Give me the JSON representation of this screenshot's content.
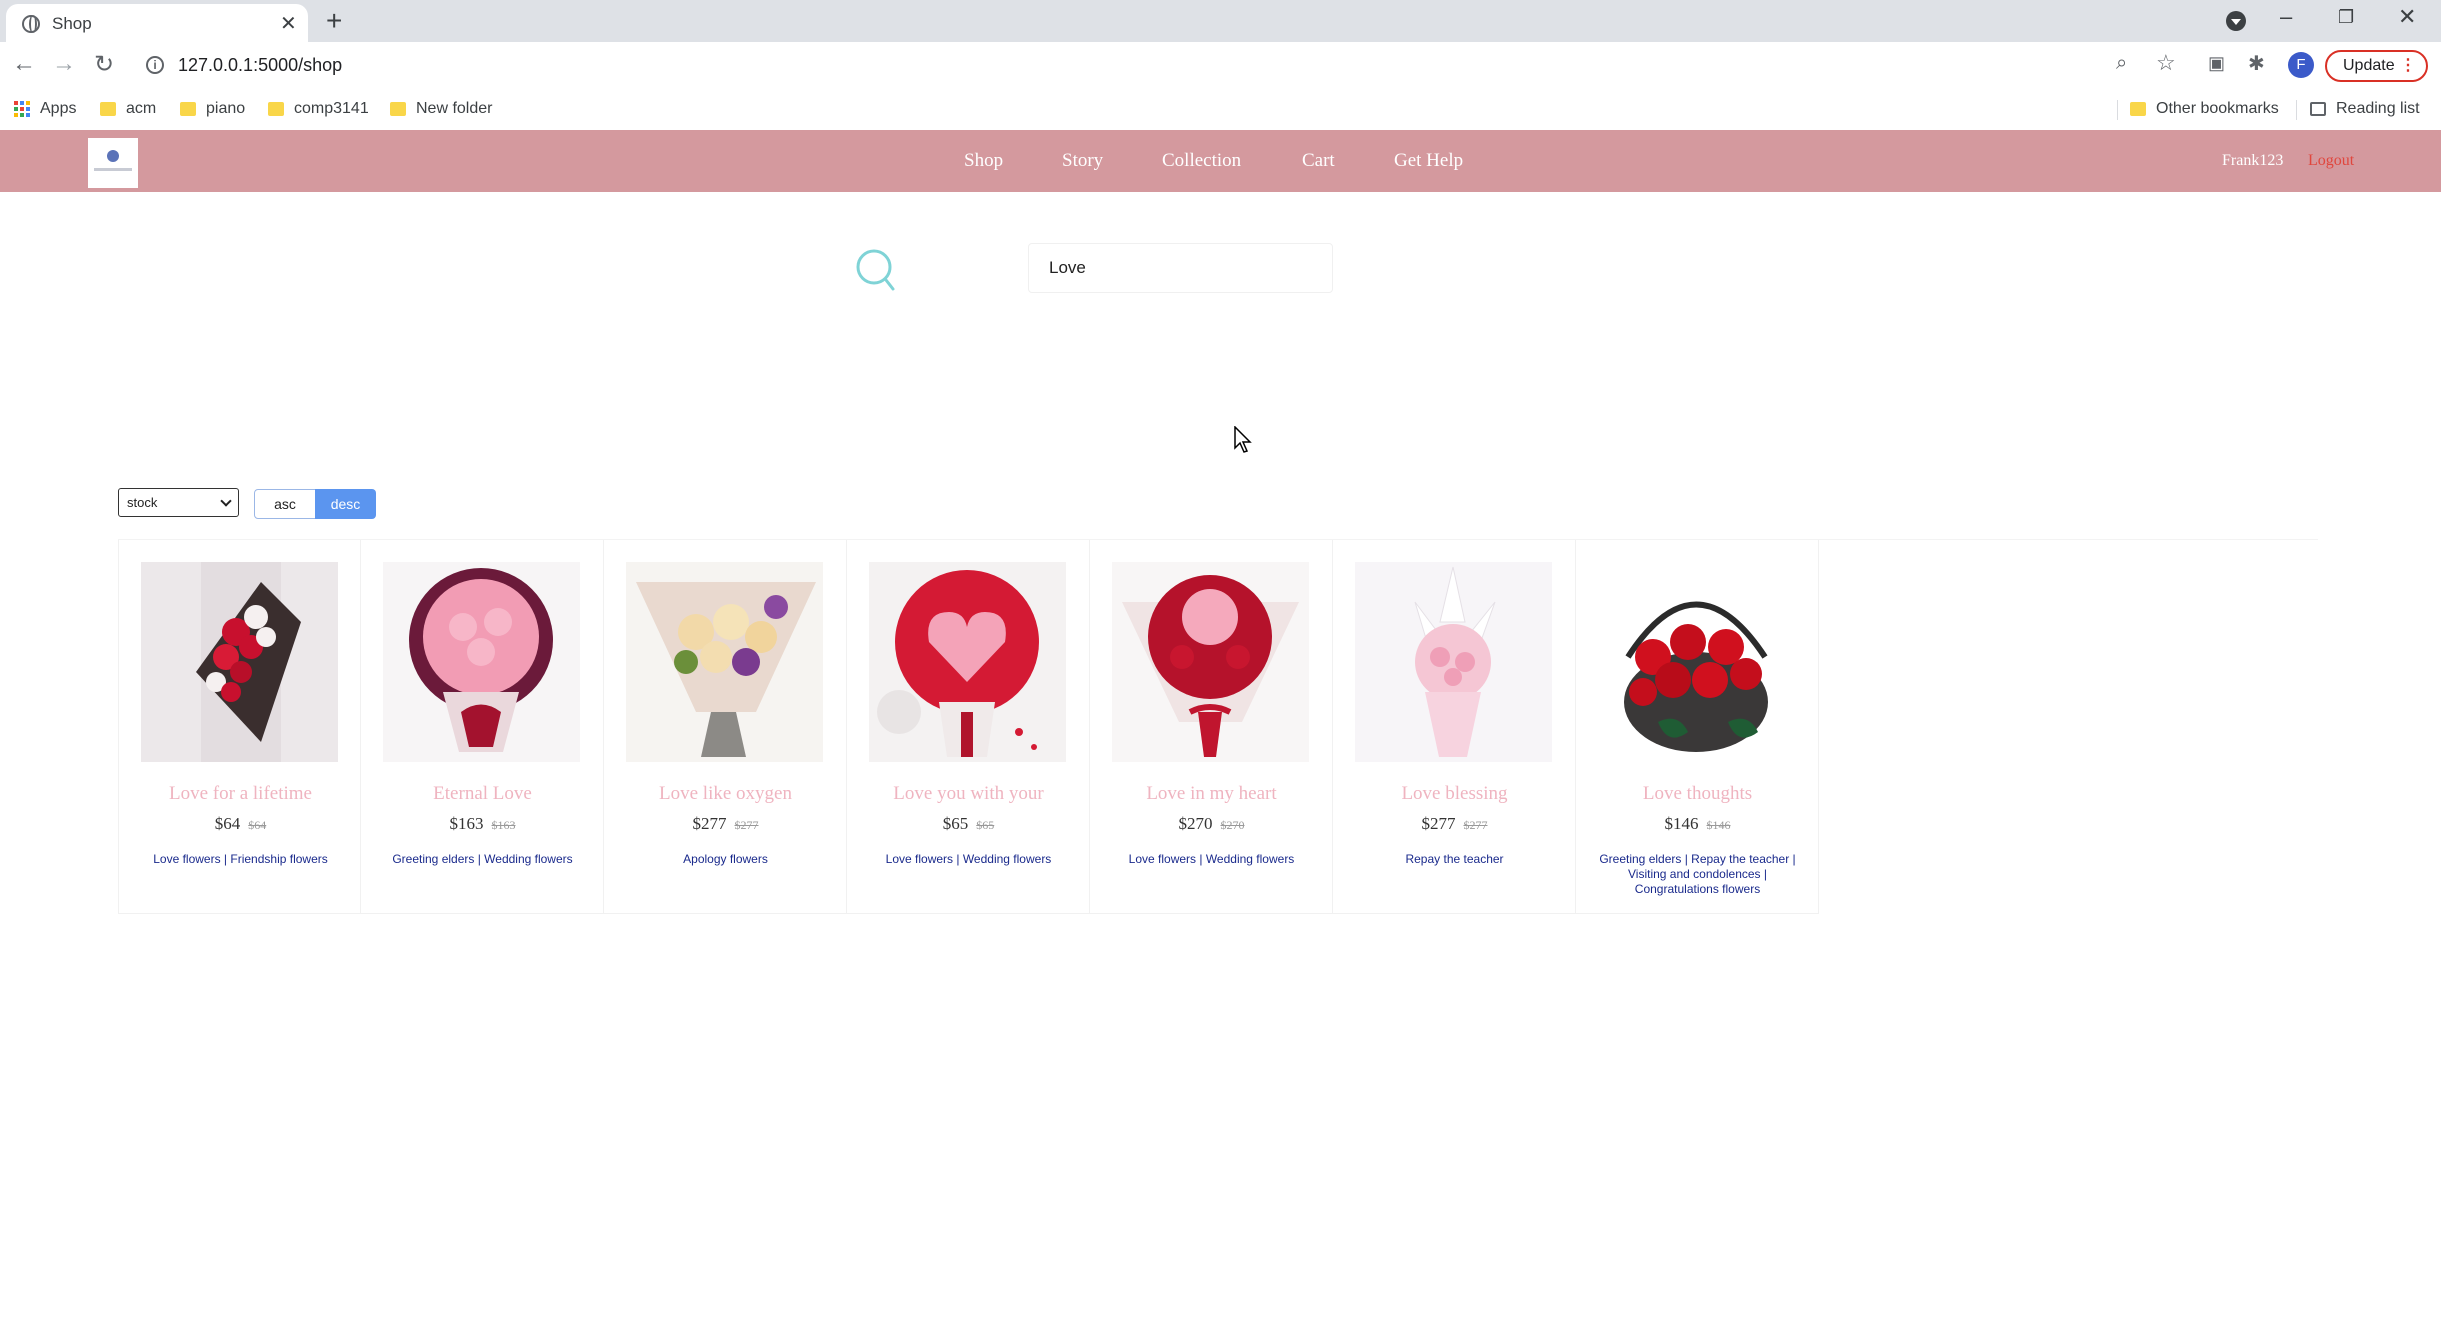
{
  "browser": {
    "tab_title": "Shop",
    "url": "127.0.0.1:5000/shop",
    "avatar_letter": "F",
    "update_label": "Update",
    "bookmarks": [
      "Apps",
      "acm",
      "piano",
      "comp3141",
      "New folder"
    ],
    "other_bookmarks": "Other bookmarks",
    "reading_list": "Reading list"
  },
  "site": {
    "nav": [
      "Shop",
      "Story",
      "Collection",
      "Cart",
      "Get Help"
    ],
    "username": "Frank123",
    "logout": "Logout"
  },
  "search": {
    "value": "Love"
  },
  "sort": {
    "selected": "stock",
    "asc": "asc",
    "desc": "desc",
    "active": "desc"
  },
  "products": [
    {
      "name": "Love for a lifetime",
      "price": "$64",
      "old_price": "$64",
      "tags": "Love flowers | Friendship flowers"
    },
    {
      "name": "Eternal Love",
      "price": "$163",
      "old_price": "$163",
      "tags": "Greeting elders | Wedding flowers"
    },
    {
      "name": "Love like oxygen",
      "price": "$277",
      "old_price": "$277",
      "tags": "Apology flowers"
    },
    {
      "name": "Love you with your",
      "price": "$65",
      "old_price": "$65",
      "tags": "Love flowers | Wedding flowers"
    },
    {
      "name": "Love in my heart",
      "price": "$270",
      "old_price": "$270",
      "tags": "Love flowers | Wedding flowers"
    },
    {
      "name": "Love blessing",
      "price": "$277",
      "old_price": "$277",
      "tags": "Repay the teacher"
    },
    {
      "name": "Love thoughts",
      "price": "$146",
      "old_price": "$146",
      "tags": "Greeting elders | Repay the teacher | Visiting and condolences | Congratulations flowers"
    }
  ],
  "colors": {
    "nav_bg": "#d4999e",
    "product_name": "#efb4c0",
    "tag_link": "#1a2a8c",
    "desc_active": "#5b95ef",
    "logout": "#e0463d"
  }
}
